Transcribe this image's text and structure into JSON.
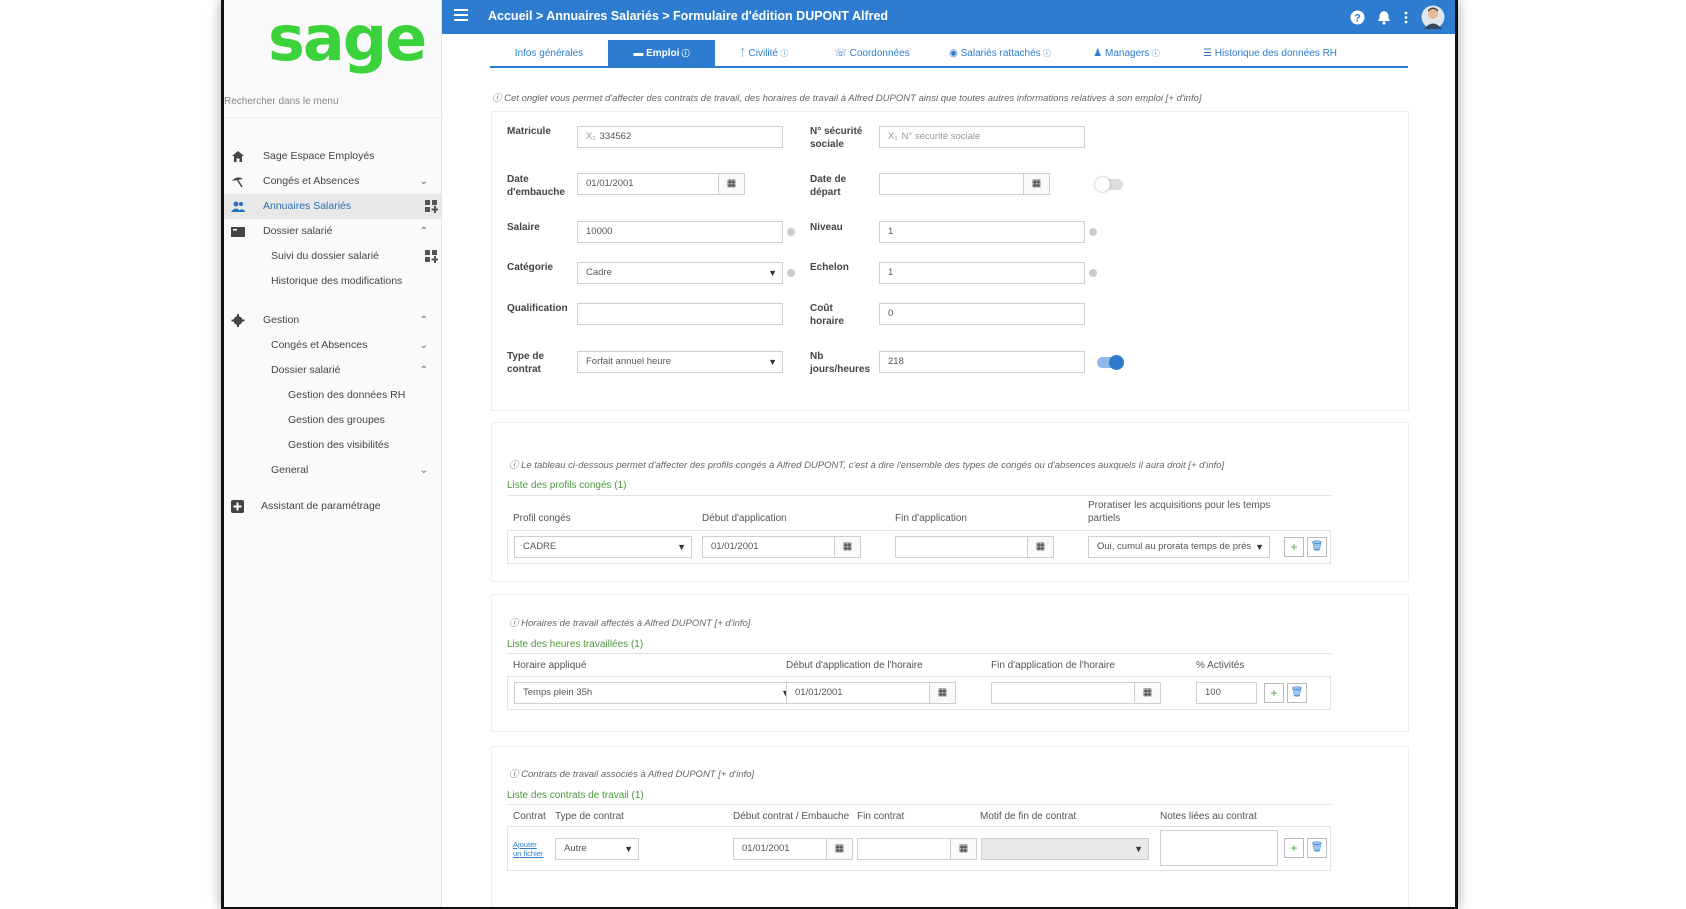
{
  "app": {
    "logo": "sage"
  },
  "sidebar": {
    "search_placeholder": "Rechercher dans le menu",
    "items": [
      {
        "label": "Sage Espace Employés",
        "icon": "home-icon"
      },
      {
        "label": "Congés et Absences",
        "icon": "beach-umbrella-icon"
      },
      {
        "label": "Annuaires Salariés",
        "icon": "users-icon"
      },
      {
        "label": "Dossier salarié",
        "icon": "folder-icon"
      },
      {
        "label": "Suivi du dossier salarié"
      },
      {
        "label": "Historique des modifications"
      },
      {
        "label": "Gestion",
        "icon": "gear-icon"
      },
      {
        "label": "Congés et Absences"
      },
      {
        "label": "Dossier salarié"
      },
      {
        "label": "Gestion des données RH"
      },
      {
        "label": "Gestion des groupes"
      },
      {
        "label": "Gestion des visibilités"
      },
      {
        "label": "General"
      },
      {
        "label": "Assistant de paramétrage",
        "icon": "plus-square-icon"
      }
    ]
  },
  "topbar": {
    "breadcrumb": "Accueil > Annuaires Salariés > Formulaire d'édition DUPONT Alfred",
    "color": "#2e7ccf"
  },
  "tabs": [
    {
      "label": "Infos générales"
    },
    {
      "label": "Emploi"
    },
    {
      "label": "Civilité"
    },
    {
      "label": "Coordonnées"
    },
    {
      "label": "Salariés rattachés"
    },
    {
      "label": "Managers"
    },
    {
      "label": "Historique des données RH"
    }
  ],
  "emploi": {
    "info": "Cet onglet vous permet d'affecter des contrats de travail, des horaires de travail à Alfred DUPONT ainsi que toutes autres informations relatives à son emploi [+ d'info]",
    "matricule_label": "Matricule",
    "matricule_prefix": "X₁",
    "matricule_value": "334562",
    "secu_label_1": "N° sécurité",
    "secu_label_2": "sociale",
    "secu_prefix": "X₁",
    "secu_placeholder": "N° sécurité sociale",
    "embauche_label_1": "Date",
    "embauche_label_2": "d'embauche",
    "embauche_value": "01/01/2001",
    "depart_label_1": "Date de",
    "depart_label_2": "départ",
    "depart_value": "",
    "salaire_label": "Salaire",
    "salaire_value": "10000",
    "niveau_label": "Niveau",
    "niveau_value": "1",
    "categorie_label": "Catégorie",
    "categorie_value": "Cadre",
    "echelon_label": "Echelon",
    "echelon_value": "1",
    "qualification_label": "Qualification",
    "qualification_value": "",
    "cout_label_1": "Coût",
    "cout_label_2": "horaire",
    "cout_value": "0",
    "type_contrat_label_1": "Type de",
    "type_contrat_label_2": "contrat",
    "type_contrat_value": "Forfait annuel heure",
    "nb_label_1": "Nb",
    "nb_label_2": "jours/heures",
    "nb_value": "218"
  },
  "conges": {
    "info": "Le tableau ci-dessous permet d'affecter des profils congés à Alfred DUPONT, c'est à dire l'ensemble des types de congés ou d'absences auxquels il aura droit [+ d'info]",
    "list_title": "Liste des profils congés (1)",
    "col_profil": "Profil congés",
    "col_debut": "Début d'application",
    "col_fin": "Fin d'application",
    "col_prorata_1": "Proratiser les acquisitions pour les temps",
    "col_prorata_2": "partiels",
    "row": {
      "profil": "CADRE",
      "debut": "01/01/2001",
      "fin": "",
      "prorata": "Oui, cumul au prorata temps de prés"
    }
  },
  "horaires": {
    "info": "Horaires de travail affectés à Alfred DUPONT [+ d'info]",
    "list_title": "Liste des heures travaillées (1)",
    "col_horaire": "Horaire appliqué",
    "col_debut": "Début d'application de l'horaire",
    "col_fin": "Fin d'application de l'horaire",
    "col_activite": "% Activités",
    "row": {
      "horaire": "Temps plein 35h",
      "debut": "01/01/2001",
      "fin": "",
      "activite": "100"
    }
  },
  "contrats": {
    "info": "Contrats de travail associés à Alfred DUPONT [+ d'info]",
    "list_title": "Liste des contrats de travail (1)",
    "col_contrat": "Contrat",
    "col_type": "Type de contrat",
    "col_debut": "Début contrat / Embauche",
    "col_fin": "Fin contrat",
    "col_motif": "Motif de fin de contrat",
    "col_notes": "Notes liées au contrat",
    "row": {
      "ajouter_1": "Ajouter",
      "ajouter_2": "un fichier",
      "type": "Autre",
      "debut": "01/01/2001",
      "fin": "",
      "motif": "",
      "notes": ""
    }
  }
}
